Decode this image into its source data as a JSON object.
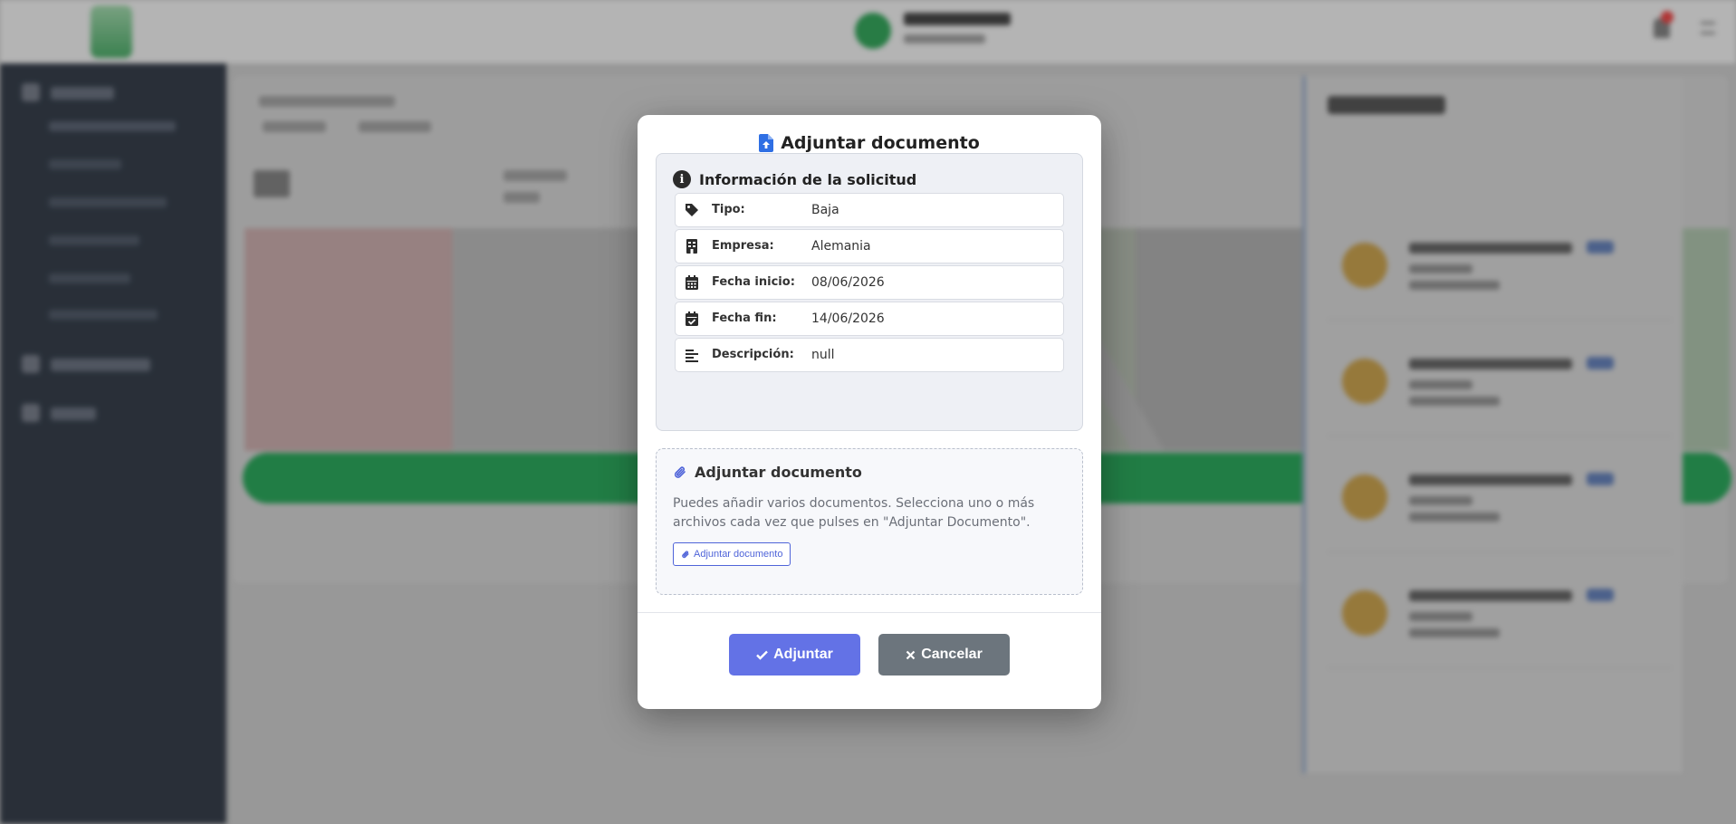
{
  "modal": {
    "title": "Adjuntar documento",
    "info": {
      "heading": "Información de la solicitud",
      "fields": [
        {
          "label": "Tipo:",
          "value": "Baja",
          "icon": "tag-icon"
        },
        {
          "label": "Empresa:",
          "value": "Alemania",
          "icon": "building-icon"
        },
        {
          "label": "Fecha inicio:",
          "value": "08/06/2026",
          "icon": "calendar-icon"
        },
        {
          "label": "Fecha fin:",
          "value": "14/06/2026",
          "icon": "calendar-check-icon"
        },
        {
          "label": "Descripción:",
          "value": "null",
          "icon": "align-left-icon"
        }
      ]
    },
    "attach": {
      "heading": "Adjuntar documento",
      "text": "Puedes añadir varios documentos. Selecciona uno o más archivos cada vez que pulses en \"Adjuntar Documento\".",
      "button_label": "Adjuntar documento"
    },
    "buttons": {
      "submit_label": "Adjuntar",
      "cancel_label": "Cancelar"
    }
  },
  "colors": {
    "primary": "#6372e6",
    "secondary": "#6c757d",
    "sidebar": "#1f2937",
    "accent_green": "#13a04a"
  }
}
